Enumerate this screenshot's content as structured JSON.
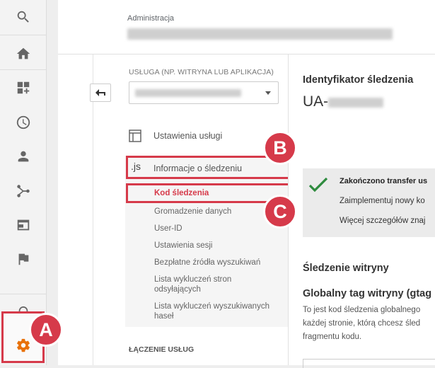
{
  "rail": {
    "items": [
      {
        "name": "search-icon"
      },
      {
        "name": "home-icon"
      },
      {
        "name": "customization-icon"
      },
      {
        "name": "realtime-clock-icon"
      },
      {
        "name": "audience-person-icon"
      },
      {
        "name": "acquisition-icon"
      },
      {
        "name": "behavior-icon"
      },
      {
        "name": "conversions-flag-icon"
      },
      {
        "name": "discover-lightbulb-icon"
      },
      {
        "name": "admin-gear-icon"
      }
    ],
    "accent_color": "#e8710a"
  },
  "badges": {
    "a": "A",
    "b": "B",
    "c": "C",
    "color": "#d63a4a"
  },
  "header": {
    "crumb": "Administracja"
  },
  "property": {
    "label": "USŁUGA (NP. WITRYNA LUB APLIKACJA)",
    "nav": {
      "settings": "Ustawienia usługi",
      "tracking_info": "Informacje o śledzeniu",
      "js_label": ".js"
    },
    "sub_items": [
      "Kod śledzenia",
      "Gromadzenie danych",
      "User-ID",
      "Ustawienia sesji",
      "Bezpłatne źródła wyszukiwań",
      "Lista wykluczeń stron odsyłających",
      "Lista wykluczeń wyszukiwanych haseł"
    ],
    "links_section": "ŁĄCZENIE USŁUG"
  },
  "tracking": {
    "id_title": "Identyfikator śledzenia",
    "id_prefix": "UA-",
    "notice_title": "Zakończono transfer us",
    "notice_line1": "Zaimplementuj nowy ko",
    "notice_line2": "Więcej szczegółów znaj",
    "site_tracking": "Śledzenie witryny",
    "global_tag": "Globalny tag witryny (gtag",
    "desc1": "To jest kod śledzenia globalnego",
    "desc2": "każdej stronie, którą chcesz śled",
    "desc3": "fragmentu kodu."
  }
}
